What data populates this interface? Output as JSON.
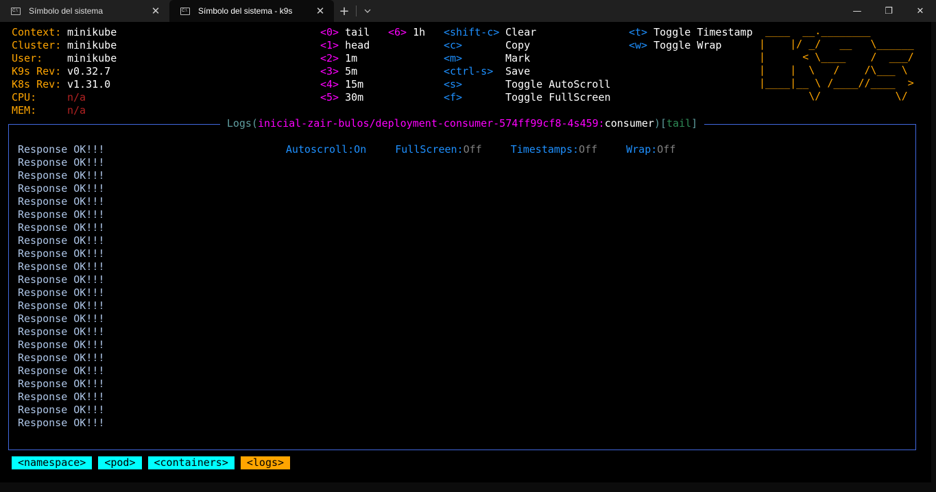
{
  "window": {
    "tabs": [
      {
        "label": "Símbolo del sistema",
        "active": false
      },
      {
        "label": "Símbolo del sistema - k9s",
        "active": true
      }
    ],
    "new_tab_label": "+",
    "dropdown_icon": "chevron-down-icon",
    "controls": {
      "minimize": "—",
      "maximize": "❐",
      "close": "✕"
    }
  },
  "info": [
    {
      "label": "Context:",
      "value": "minikube",
      "value_color": "white"
    },
    {
      "label": "Cluster:",
      "value": "minikube",
      "value_color": "white"
    },
    {
      "label": "User:",
      "value": "minikube",
      "value_color": "white"
    },
    {
      "label": "K9s Rev:",
      "value": "v0.32.7",
      "value_color": "white"
    },
    {
      "label": "K8s Rev:",
      "value": "v1.31.0",
      "value_color": "white"
    },
    {
      "label": "CPU:",
      "value": "n/a",
      "value_color": "red"
    },
    {
      "label": "MEM:",
      "value": "n/a",
      "value_color": "red"
    }
  ],
  "tail_keys": [
    {
      "key": "<0>",
      "label": "tail"
    },
    {
      "key": "<1>",
      "label": "head"
    },
    {
      "key": "<2>",
      "label": "1m"
    },
    {
      "key": "<3>",
      "label": "5m"
    },
    {
      "key": "<4>",
      "label": "15m"
    },
    {
      "key": "<5>",
      "label": "30m"
    }
  ],
  "extra_key": {
    "key": "<6>",
    "label": "1h"
  },
  "action_keys": [
    {
      "key": "<shift-c>",
      "label": "Clear"
    },
    {
      "key": "<c>",
      "label": "Copy"
    },
    {
      "key": "<m>",
      "label": "Mark"
    },
    {
      "key": "<ctrl-s>",
      "label": "Save"
    },
    {
      "key": "<s>",
      "label": "Toggle AutoScroll"
    },
    {
      "key": "<f>",
      "label": "Toggle FullScreen"
    }
  ],
  "toggle_keys": [
    {
      "key": "<t>",
      "label": "Toggle Timestamp"
    },
    {
      "key": "<w>",
      "label": "Toggle Wrap"
    }
  ],
  "logo_lines": [
    " ____  __.________       ",
    "|    |/ _/   __   \\______",
    "|      < \\____    /  ___/",
    "|    |  \\   /    /\\___ \\ ",
    "|____|__ \\ /____//____  >",
    "        \\/            \\/ "
  ],
  "logs": {
    "title_prefix": "Logs(",
    "target": "inicial-zair-bulos/deployment-consumer-574ff99cf8-4s459:",
    "container": "consumer",
    "title_close": ")",
    "mode_open": "[",
    "mode": "tail",
    "mode_close": "]",
    "status": [
      {
        "label": "Autoscroll:",
        "value": "On",
        "value_on": true
      },
      {
        "label": "FullScreen:",
        "value": "Off",
        "value_on": false
      },
      {
        "label": "Timestamps:",
        "value": "Off",
        "value_on": false
      },
      {
        "label": "Wrap:",
        "value": "Off",
        "value_on": false
      }
    ],
    "lines": [
      "Response OK!!!",
      "Response OK!!!",
      "Response OK!!!",
      "Response OK!!!",
      "Response OK!!!",
      "Response OK!!!",
      "Response OK!!!",
      "Response OK!!!",
      "Response OK!!!",
      "Response OK!!!",
      "Response OK!!!",
      "Response OK!!!",
      "Response OK!!!",
      "Response OK!!!",
      "Response OK!!!",
      "Response OK!!!",
      "Response OK!!!",
      "Response OK!!!",
      "Response OK!!!",
      "Response OK!!!",
      "Response OK!!!",
      "Response OK!!!"
    ]
  },
  "breadcrumbs": [
    {
      "label": "<namespace>",
      "active": false
    },
    {
      "label": "<pod>",
      "active": false
    },
    {
      "label": "<containers>",
      "active": false
    },
    {
      "label": "<logs>",
      "active": true
    }
  ],
  "colors": {
    "label": "#ffa500",
    "key_tail": "#ff00ff",
    "key_action": "#1e90ff",
    "border": "#4169e1",
    "crumb": "#00ffff",
    "crumb_active": "#ffa500"
  }
}
